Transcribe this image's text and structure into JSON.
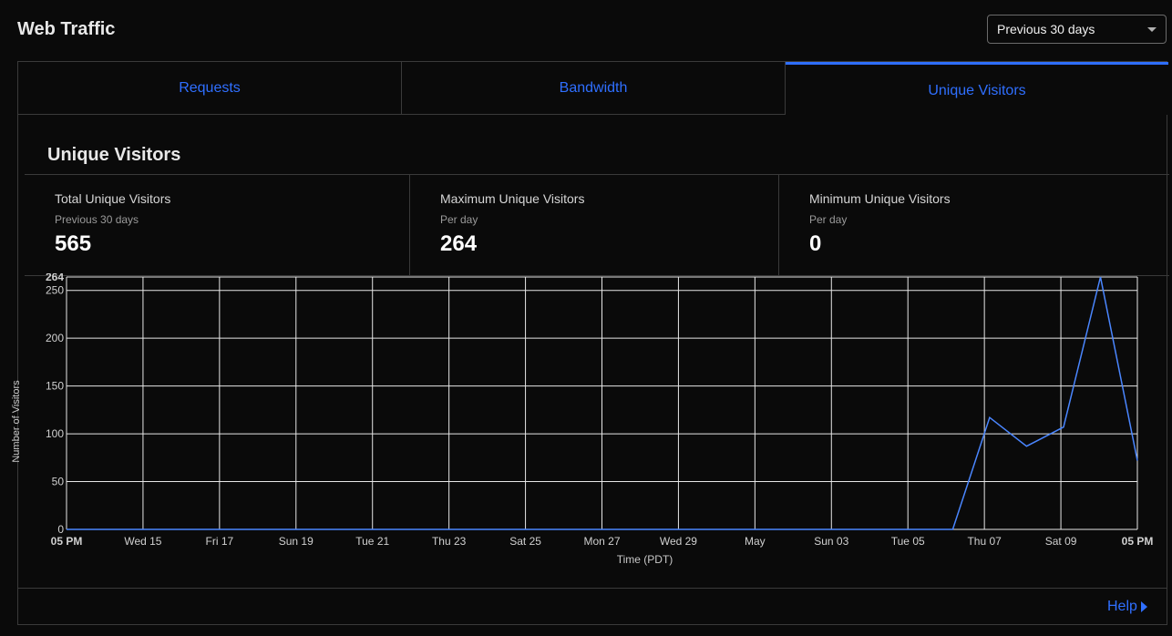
{
  "header": {
    "title": "Web Traffic",
    "range_select": {
      "value": "Previous 30 days",
      "icon": "caret-down-icon"
    }
  },
  "tabs": [
    {
      "label": "Requests",
      "active": false
    },
    {
      "label": "Bandwidth",
      "active": false
    },
    {
      "label": "Unique Visitors",
      "active": true
    }
  ],
  "section": {
    "title": "Unique Visitors"
  },
  "stats": [
    {
      "title": "Total Unique Visitors",
      "sub": "Previous 30 days",
      "value": "565"
    },
    {
      "title": "Maximum Unique Visitors",
      "sub": "Per day",
      "value": "264"
    },
    {
      "title": "Minimum Unique Visitors",
      "sub": "Per day",
      "value": "0"
    }
  ],
  "colors": {
    "accent": "#2f6fff",
    "line": "#4a86ff",
    "grid": "#e6e6e6",
    "background": "#0a0a0a"
  },
  "chart_data": {
    "type": "line",
    "xlabel": "Time (PDT)",
    "ylabel": "Number of Visitors",
    "ylim": [
      0,
      264
    ],
    "y_ticks": [
      0,
      50,
      100,
      150,
      200,
      250,
      264
    ],
    "x_tick_labels": [
      "05 PM",
      "Wed 15",
      "Fri 17",
      "Sun 19",
      "Tue 21",
      "Thu 23",
      "Sat 25",
      "Mon 27",
      "Wed 29",
      "May",
      "Sun 03",
      "Tue 05",
      "Thu 07",
      "Sat 09",
      "05 PM"
    ],
    "grid": true,
    "series": [
      {
        "values": [
          0,
          0,
          0,
          0,
          0,
          0,
          0,
          0,
          0,
          0,
          0,
          0,
          0,
          0,
          0,
          0,
          0,
          0,
          0,
          0,
          0,
          0,
          0,
          0,
          0,
          117,
          87,
          107,
          264,
          72
        ]
      }
    ]
  },
  "footer": {
    "help_label": "Help",
    "help_icon": "caret-right-icon"
  }
}
